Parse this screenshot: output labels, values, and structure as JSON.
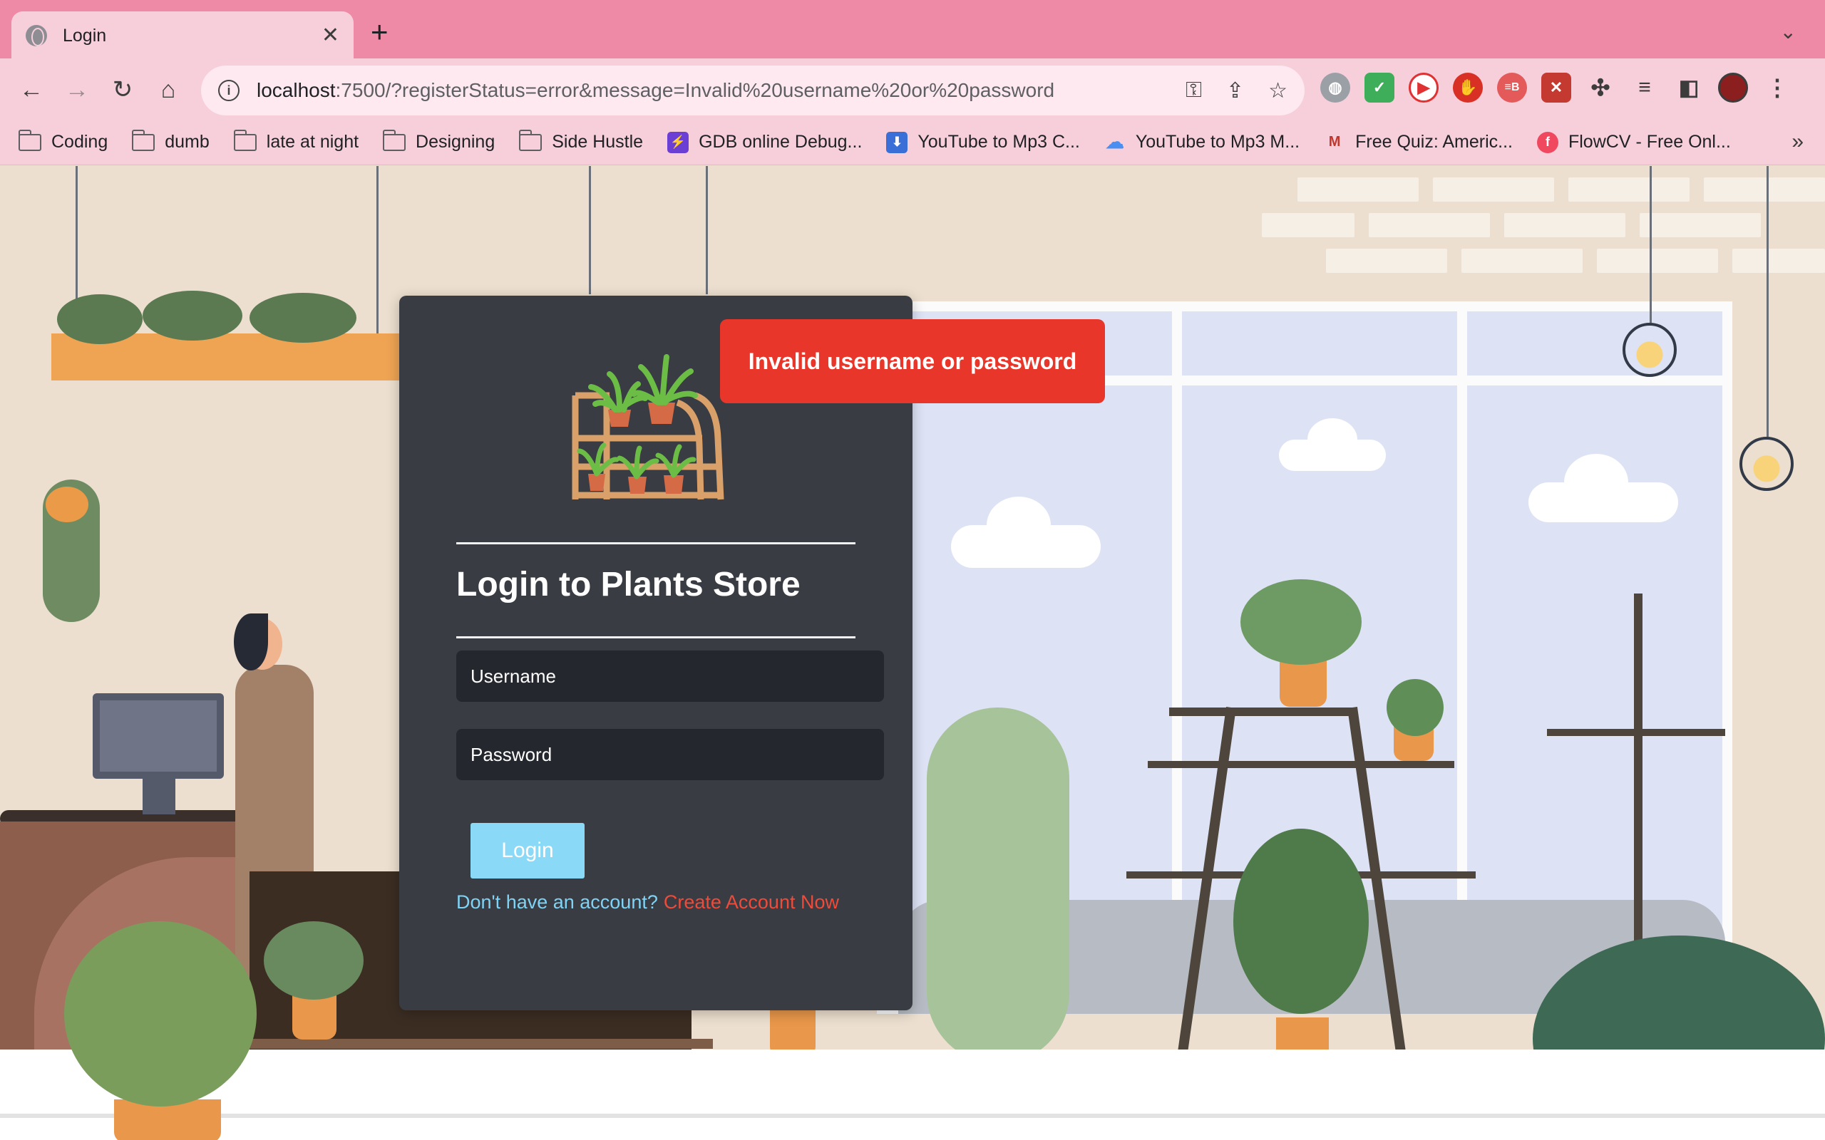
{
  "browser": {
    "tab_title": "Login",
    "url_host": "localhost",
    "url_rest": ":7500/?registerStatus=error&message=Invalid%20username%20or%20password",
    "bookmarks": [
      {
        "label": "Coding",
        "type": "folder"
      },
      {
        "label": "dumb",
        "type": "folder"
      },
      {
        "label": "late at night",
        "type": "folder"
      },
      {
        "label": "Designing",
        "type": "folder"
      },
      {
        "label": "Side Hustle",
        "type": "folder"
      },
      {
        "label": "GDB online Debug...",
        "type": "site",
        "color": "#6b3fd4"
      },
      {
        "label": "YouTube to Mp3 C...",
        "type": "site",
        "color": "#3b6fd8"
      },
      {
        "label": "YouTube to Mp3 M...",
        "type": "site",
        "color": "#4a8ef2"
      },
      {
        "label": "Free Quiz: Americ...",
        "type": "site",
        "color": "#c2362c"
      },
      {
        "label": "FlowCV - Free Onl...",
        "type": "site",
        "color": "#f0485f"
      }
    ]
  },
  "login": {
    "title": "Login to Plants Store",
    "username_placeholder": "Username",
    "password_placeholder": "Password",
    "login_label": "Login",
    "no_account_text": "Don't have an account?",
    "create_account_label": "Create Account Now"
  },
  "toast": {
    "message": "Invalid username or password"
  },
  "colors": {
    "card_bg": "#393c42",
    "toast_bg": "#e8372a",
    "login_button": "#8ad9f7",
    "link_red": "#ee4b3b",
    "chrome_pink": "#ef8aa6"
  }
}
